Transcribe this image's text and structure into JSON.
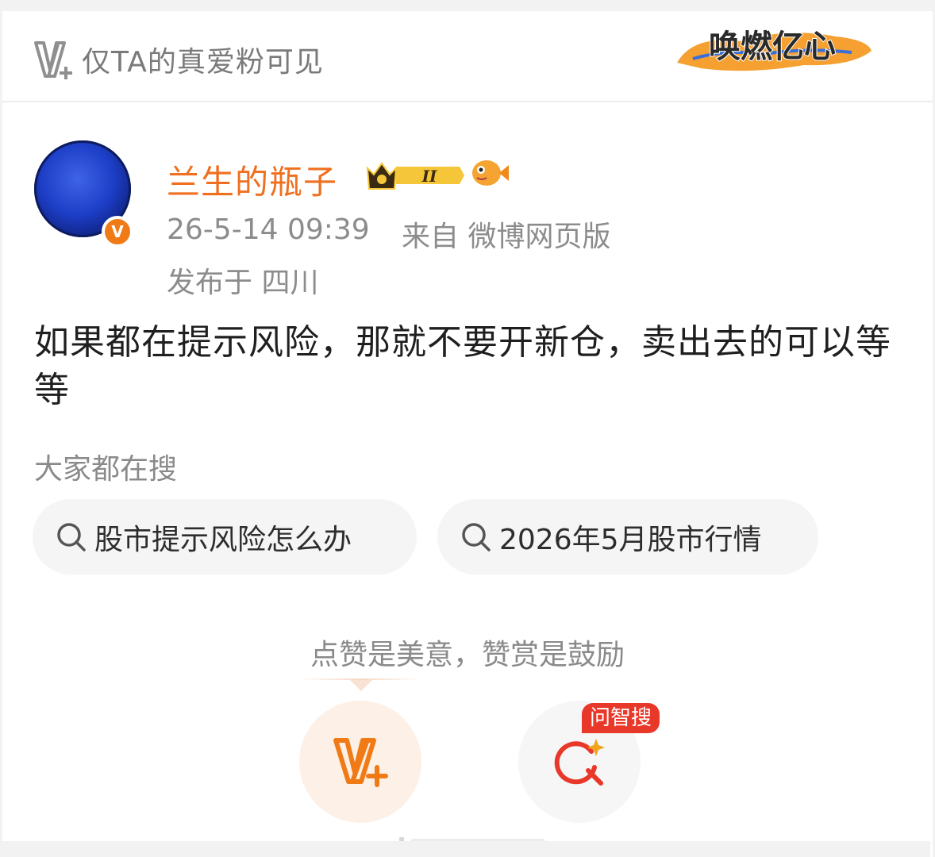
{
  "header": {
    "visibility_label": "仅TA的真爱粉可见",
    "banner_text": "唤燃亿心"
  },
  "user": {
    "name": "兰生的瓶子",
    "badge_level": "II",
    "verify_mark": "V"
  },
  "post": {
    "time": "26-5-14 09:39",
    "source": "来自 微博网页版",
    "location": "发布于 四川",
    "text": "如果都在提示风险，那就不要开新仓，卖出去的可以等等"
  },
  "search": {
    "title": "大家都在搜",
    "chips": [
      {
        "label": "股市提示风险怎么办",
        "icon": "search-icon"
      },
      {
        "label": "2026年5月股市行情",
        "icon": "search-icon"
      }
    ]
  },
  "actions": {
    "tip": "点赞是美意，赞赏是鼓励",
    "ask_badge": "问智搜"
  },
  "colors": {
    "accent": "#f06f1f",
    "brand_red": "#e8382a",
    "muted": "#8a8a8a"
  }
}
